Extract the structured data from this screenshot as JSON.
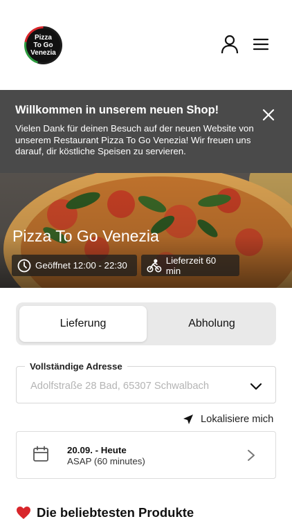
{
  "header": {
    "logo_lines": [
      "Pizza",
      "To Go",
      "Venezia"
    ],
    "icons": {
      "account": "user-icon",
      "menu": "hamburger-menu-icon"
    }
  },
  "banner": {
    "title": "Willkommen in unserem neuen Shop!",
    "text": "Vielen Dank für deinen Besuch auf der neuen Website von unserem Restaurant Pizza To Go Venezia! Wir freuen uns darauf, dir köstliche Speisen zu servieren.",
    "close_icon": "close-icon"
  },
  "hero": {
    "title": "Pizza To Go Venezia",
    "opening_hours": "Geöffnet 12:00 - 22:30",
    "delivery_time": "Lieferzeit 60 min"
  },
  "order_mode": {
    "options": [
      "Lieferung",
      "Abholung"
    ],
    "selected": "Lieferung"
  },
  "address": {
    "label": "Vollständige Adresse",
    "value": "Adolfstraße 28 Bad, 65307 Schwalbach"
  },
  "locate": {
    "label": "Lokalisiere mich"
  },
  "time": {
    "date": "20.09. - Heute",
    "slot": "ASAP (60 minutes)"
  },
  "popular": {
    "title": "Die beliebtesten Produkte"
  },
  "colors": {
    "banner_bg": "#4a4a4a",
    "toggle_bg": "#e9e9e9",
    "logo_green": "#2e9b3f",
    "logo_red": "#d8262b",
    "heart": "#d8262b"
  }
}
